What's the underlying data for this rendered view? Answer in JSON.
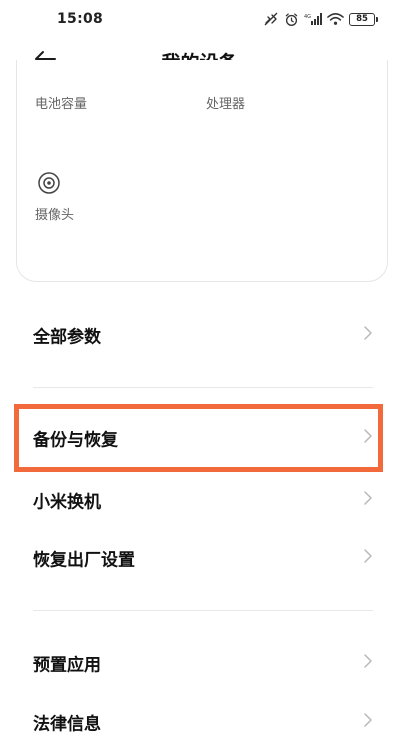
{
  "status_bar": {
    "time": "15:08",
    "battery": "85",
    "icons": [
      "nfc-icon",
      "alarm-icon",
      "signal-icon",
      "wifi-icon",
      "battery-icon"
    ]
  },
  "header": {
    "title": "我的设备",
    "back_icon": "back-arrow-icon"
  },
  "spec_card": {
    "battery_label": "电池容量",
    "processor_label": "处理器",
    "camera_label": "摄像头",
    "camera_icon": "camera-icon"
  },
  "menu": {
    "all_params": "全部参数",
    "backup_restore": "备份与恢复",
    "mi_mover": "小米换机",
    "factory_reset": "恢复出厂设置",
    "preinstalled_apps": "预置应用",
    "legal_info": "法律信息"
  },
  "colors": {
    "highlight": "#f26a3b",
    "text_primary": "#111111",
    "text_secondary": "#666666",
    "chevron": "#b8b8b8"
  }
}
